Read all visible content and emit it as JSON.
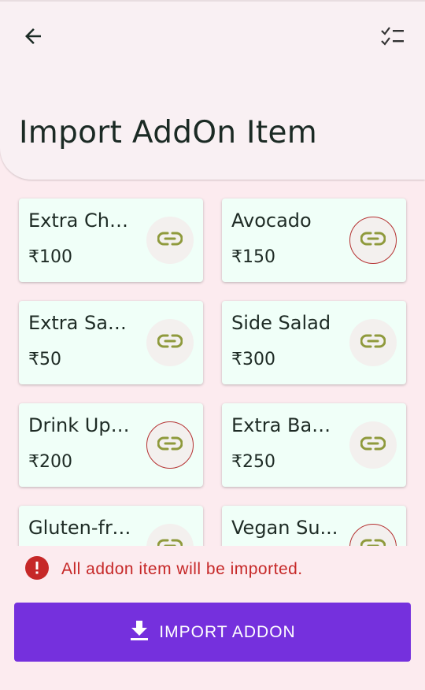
{
  "header": {
    "title": "Import AddOn Item",
    "back_icon": "arrow-back-icon",
    "checklist_icon": "checklist-icon"
  },
  "items": [
    {
      "name": "Extra Che...",
      "price": "₹100",
      "selected": false
    },
    {
      "name": "Avocado",
      "price": "₹150",
      "selected": true
    },
    {
      "name": "Extra Sau...",
      "price": "₹50",
      "selected": false
    },
    {
      "name": "Side Salad",
      "price": "₹300",
      "selected": false
    },
    {
      "name": "Drink Upg...",
      "price": "₹200",
      "selected": true
    },
    {
      "name": "Extra Bac...",
      "price": "₹250",
      "selected": false
    },
    {
      "name": "Gluten-fre...",
      "price": "",
      "selected": false
    },
    {
      "name": "Vegan Su...",
      "price": "",
      "selected": true
    }
  ],
  "info": {
    "text": "All addon item will be imported.",
    "icon": "error-icon"
  },
  "import_button": {
    "label": "IMPORT ADDON",
    "icon": "download-icon"
  },
  "colors": {
    "background": "#fcebef",
    "header": "#f9f0f3",
    "card": "#f0fff8",
    "link_icon": "#8f9a3c",
    "selected_ring": "#b53232",
    "error": "#c62828",
    "primary": "#7530dd"
  }
}
